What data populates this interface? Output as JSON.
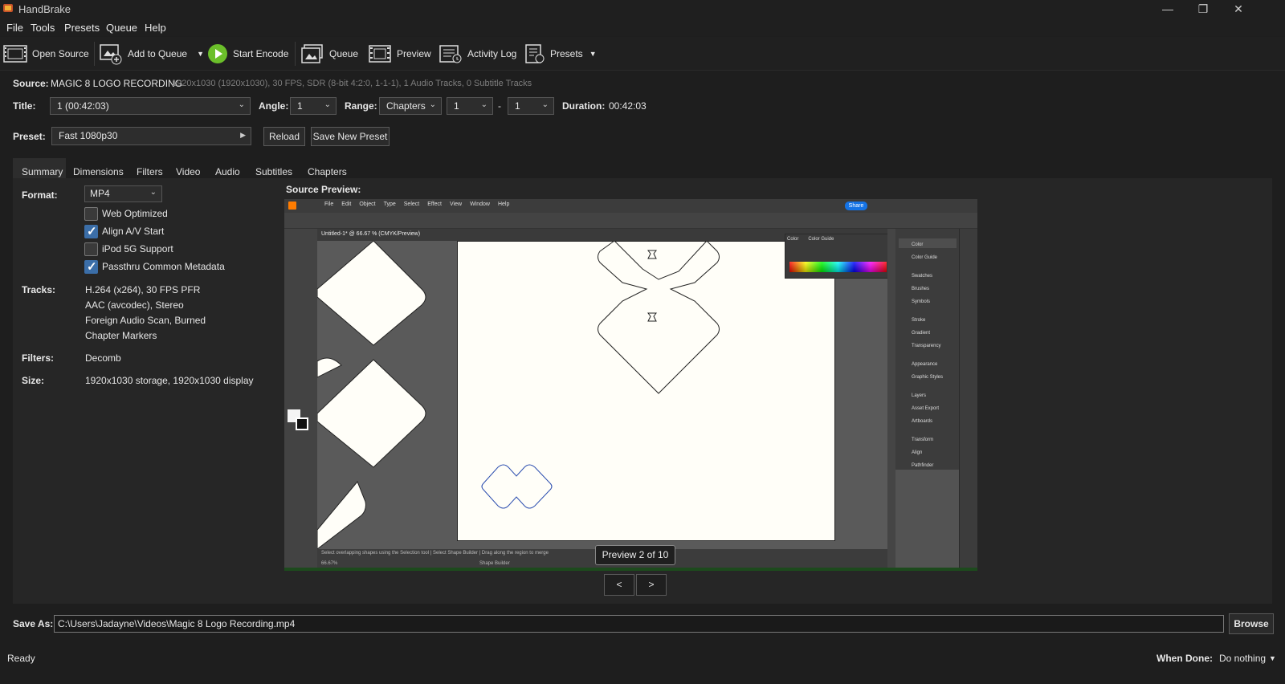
{
  "window": {
    "title": "HandBrake",
    "minimize": "—",
    "maximize": "❐",
    "close": "✕"
  },
  "menu": {
    "file": "File",
    "tools": "Tools",
    "presets": "Presets",
    "queue": "Queue",
    "help": "Help"
  },
  "toolbar": {
    "open_source": "Open Source",
    "add_to_queue": "Add to Queue",
    "start_encode": "Start Encode",
    "queue": "Queue",
    "preview": "Preview",
    "activity_log": "Activity Log",
    "presets": "Presets"
  },
  "source": {
    "label": "Source:",
    "name": "MAGIC 8 LOGO RECORDING",
    "info": "1920x1030 (1920x1030), 30 FPS, SDR (8-bit 4:2:0, 1-1-1), 1 Audio Tracks, 0 Subtitle Tracks"
  },
  "title_row": {
    "title_label": "Title:",
    "title_value": "1 (00:42:03)",
    "angle_label": "Angle:",
    "angle_value": "1",
    "range_label": "Range:",
    "range_type": "Chapters",
    "range_start": "1",
    "range_dash": "-",
    "range_end": "1",
    "duration_label": "Duration:",
    "duration_value": "00:42:03"
  },
  "preset_row": {
    "label": "Preset:",
    "value": "Fast 1080p30",
    "reload": "Reload",
    "save_new": "Save New Preset"
  },
  "tabs": [
    "Summary",
    "Dimensions",
    "Filters",
    "Video",
    "Audio",
    "Subtitles",
    "Chapters"
  ],
  "summary": {
    "format_label": "Format:",
    "format_value": "MP4",
    "options": [
      {
        "label": "Web Optimized",
        "checked": false
      },
      {
        "label": "Align A/V Start",
        "checked": true
      },
      {
        "label": "iPod 5G Support",
        "checked": false
      },
      {
        "label": "Passthru Common Metadata",
        "checked": true
      }
    ],
    "tracks_label": "Tracks:",
    "tracks": [
      "H.264 (x264), 30 FPS PFR",
      "AAC (avcodec), Stereo",
      "Foreign Audio Scan, Burned",
      "Chapter Markers"
    ],
    "filters_label": "Filters:",
    "filters_value": "Decomb",
    "size_label": "Size:",
    "size_value": "1920x1030 storage, 1920x1030 display"
  },
  "preview": {
    "label": "Source Preview:",
    "counter": "Preview 2 of 10",
    "prev": "<",
    "next": ">",
    "inner": {
      "menu": [
        "File",
        "Edit",
        "Object",
        "Type",
        "Select",
        "Effect",
        "View",
        "Window",
        "Help"
      ],
      "share": "Share",
      "doc_tab": "Untitled-1* @ 66.67 % (CMYK/Preview)",
      "color_tabs": [
        "Color",
        "Color Guide"
      ],
      "panels": [
        "Color",
        "Color Guide",
        "Swatches",
        "Brushes",
        "Symbols",
        "Stroke",
        "Gradient",
        "Transparency",
        "Appearance",
        "Graphic Styles",
        "Layers",
        "Asset Export",
        "Artboards",
        "Transform",
        "Align",
        "Pathfinder"
      ],
      "status_hint": "Select overlapping shapes using the Selection tool  |  Select Shape Builder  |  Drag along the region to merge",
      "zoom": "66.67%",
      "tool": "Shape Builder"
    }
  },
  "save_as": {
    "label": "Save As:",
    "path": "C:\\Users\\Jadayne\\Videos\\Magic 8 Logo Recording.mp4",
    "browse": "Browse"
  },
  "status": {
    "text": "Ready",
    "when_done_label": "When Done:",
    "when_done_value": "Do nothing"
  }
}
